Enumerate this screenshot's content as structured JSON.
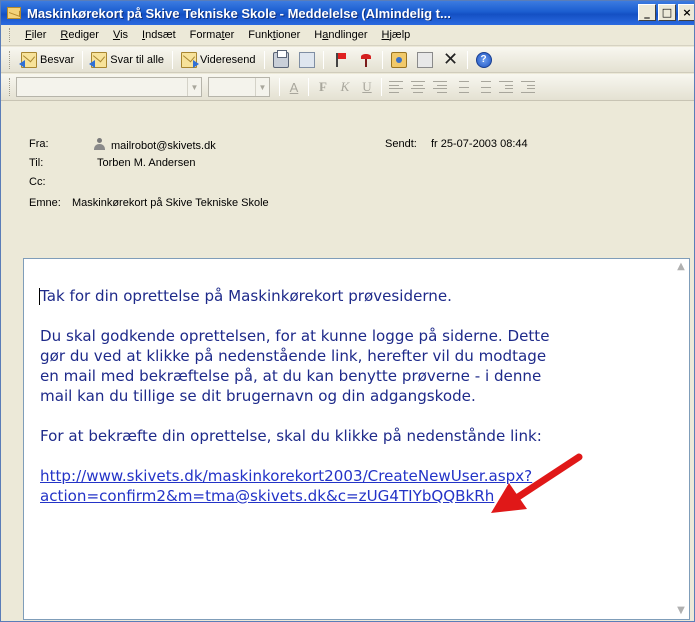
{
  "window": {
    "title": "Maskinkørekort på Skive Tekniske Skole - Meddelelse (Almindelig t...",
    "buttons": {
      "minimize": "_",
      "maximize": "□",
      "close": "×"
    }
  },
  "menu": {
    "items": [
      {
        "pre": "",
        "u": "F",
        "post": "iler"
      },
      {
        "pre": "",
        "u": "R",
        "post": "ediger"
      },
      {
        "pre": "",
        "u": "V",
        "post": "is"
      },
      {
        "pre": "",
        "u": "I",
        "post": "ndsæt"
      },
      {
        "pre": "Forma",
        "u": "t",
        "post": "er"
      },
      {
        "pre": "Funk",
        "u": "t",
        "post": "ioner"
      },
      {
        "pre": "H",
        "u": "a",
        "post": "ndlinger"
      },
      {
        "pre": "",
        "u": "H",
        "post": "jælp"
      }
    ]
  },
  "toolbar": {
    "reply": "Besvar",
    "reply_all": "Svar til alle",
    "forward": "Videresend",
    "icons": [
      "reply-icon",
      "reply-all-icon",
      "forward-icon",
      "print-icon",
      "copy-icon",
      "follow-up-flag-icon",
      "mark-flag-icon",
      "address-book-icon",
      "move-icon",
      "delete-icon",
      "help-icon"
    ]
  },
  "format_bar": {
    "bold": "F",
    "italic": "K",
    "underline": "U",
    "font_color": "A"
  },
  "header": {
    "from_label": "Fra:",
    "from_value": "mailrobot@skivets.dk",
    "sent_label": "Sendt:",
    "sent_value": "fr 25-07-2003 08:44",
    "to_label": "Til:",
    "to_value": "Torben M. Andersen",
    "cc_label": "Cc:",
    "cc_value": "",
    "subject_label": "Emne:",
    "subject_value": "Maskinkørekort på Skive Tekniske Skole"
  },
  "body": {
    "p1": "Tak for din oprettelse på Maskinkørekort prøvesiderne.",
    "p2_lines": [
      "Du skal godkende oprettelsen, for at kunne logge på siderne. Dette",
      "gør du ved at klikke på nedenstående link, herefter vil du modtage",
      "en mail med bekræftelse på, at du kan benytte prøverne - i denne",
      "mail kan du tillige se dit brugernavn og din adgangskode."
    ],
    "p3": "For at bekræfte din oprettelse, skal du klikke på nedenstånde link:",
    "link_line1": "http://www.skivets.dk/maskinkorekort2003/CreateNewUser.aspx?",
    "link_line2": "action=confirm2&m=tma@skivets.dk&c=zUG4TIYbQQBkRh"
  },
  "colors": {
    "titlebar": "#1b5dd0",
    "body_text": "#1e2a8a",
    "link": "#2333c7",
    "annotation_arrow": "#e01818"
  }
}
